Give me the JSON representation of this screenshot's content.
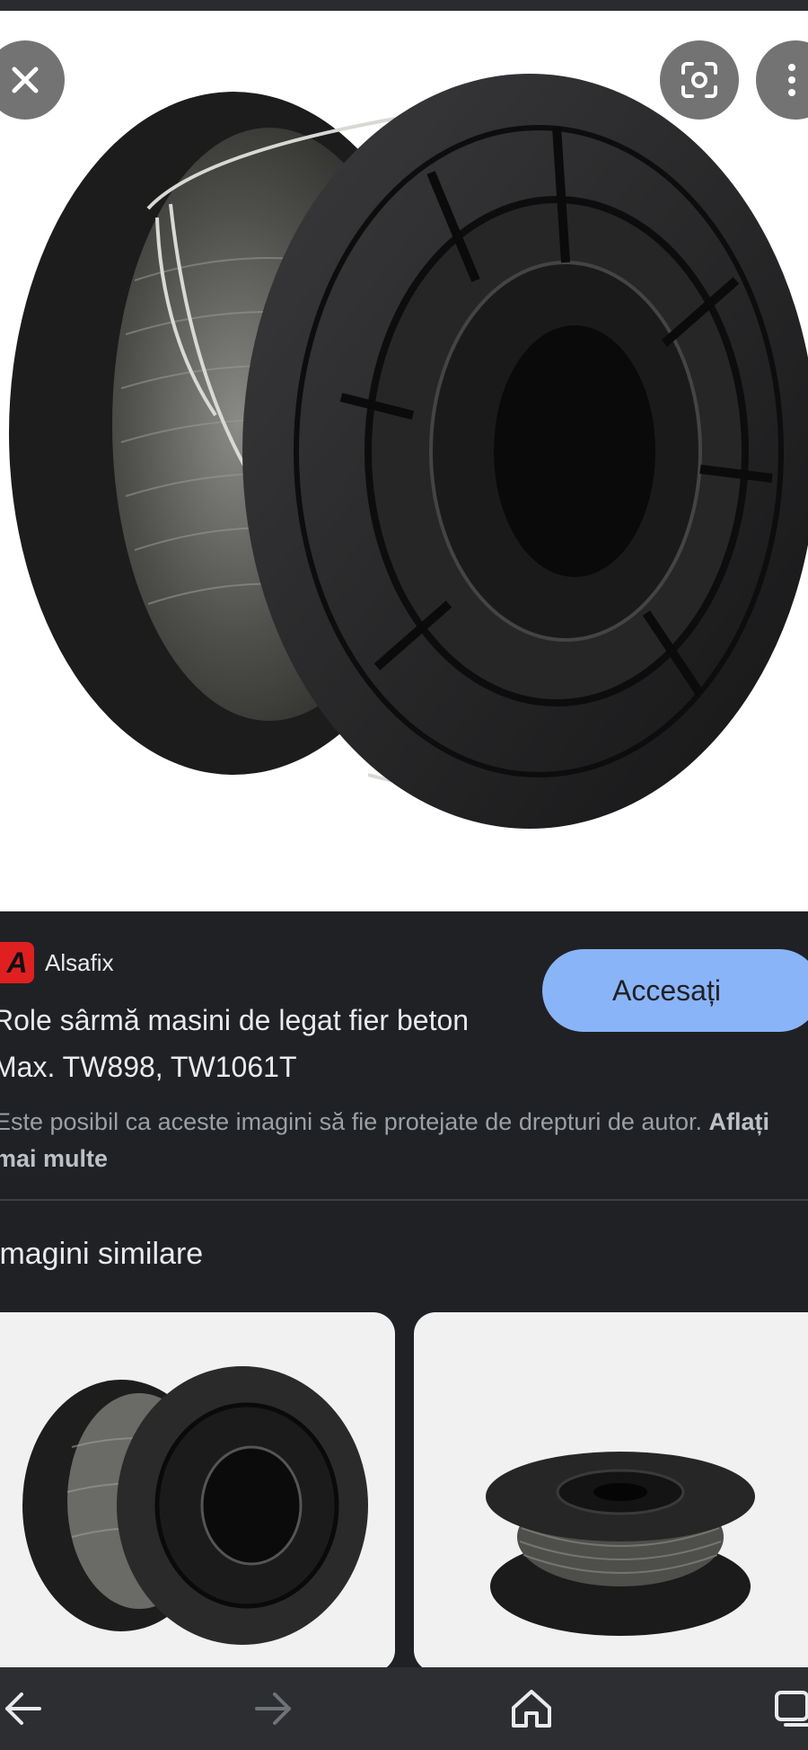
{
  "viewer": {
    "close_icon": "close-icon",
    "lens_icon": "lens-icon",
    "more_icon": "more-vertical-icon"
  },
  "result": {
    "source_name": "Alsafix",
    "source_logo_letter": "A",
    "visit_label": "Accesați",
    "title": "Role sârmă masini de legat fier beton Max. TW898, TW1061T",
    "copyright_text": "Este posibil ca aceste imagini să fie protejate de drepturi de autor.",
    "learn_more_label": "Aflați mai multe"
  },
  "similar": {
    "heading": "Imagini similare"
  },
  "bottom_nav": {
    "back_icon": "arrow-back-icon",
    "forward_icon": "arrow-forward-icon",
    "home_icon": "home-icon",
    "tabs_icon": "tabs-icon"
  },
  "colors": {
    "background": "#202124",
    "accent_button": "#8ab4f8",
    "logo_red": "#e02020"
  }
}
